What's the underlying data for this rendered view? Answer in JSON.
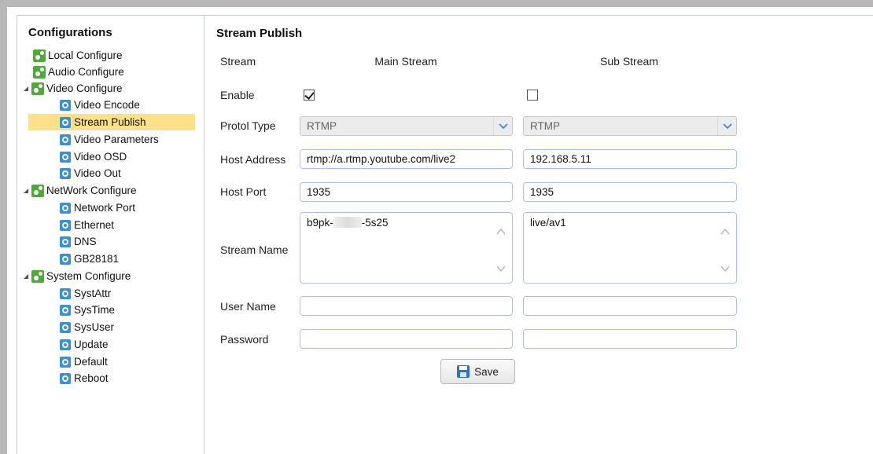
{
  "sidebar": {
    "title": "Configurations",
    "items": [
      {
        "label": "Local Configure"
      },
      {
        "label": "Audio Configure"
      },
      {
        "label": "Video Configure"
      },
      {
        "label": "Video Encode"
      },
      {
        "label": "Stream Publish"
      },
      {
        "label": "Video Parameters"
      },
      {
        "label": "Video OSD"
      },
      {
        "label": "Video Out"
      },
      {
        "label": "NetWork Configure"
      },
      {
        "label": "Network Port"
      },
      {
        "label": "Ethernet"
      },
      {
        "label": "DNS"
      },
      {
        "label": "GB28181"
      },
      {
        "label": "System Configure"
      },
      {
        "label": "SystAttr"
      },
      {
        "label": "SysTime"
      },
      {
        "label": "SysUser"
      },
      {
        "label": "Update"
      },
      {
        "label": "Default"
      },
      {
        "label": "Reboot"
      }
    ],
    "selected": "Stream Publish"
  },
  "form": {
    "title": "Stream Publish",
    "labels": {
      "stream": "Stream",
      "enable": "Enable",
      "protocol_type": "Protol Type",
      "host_address": "Host Address",
      "host_port": "Host Port",
      "stream_name": "Stream Name",
      "user_name": "User Name",
      "password": "Password"
    },
    "main": {
      "header": "Main Stream",
      "enabled": true,
      "protocol": "RTMP",
      "host_address": "rtmp://a.rtmp.youtube.com/live2",
      "host_port": "1935",
      "stream_name_prefix": "b9pk-",
      "stream_name_suffix": "-5s25",
      "user_name": "",
      "password": ""
    },
    "sub": {
      "header": "Sub Stream",
      "enabled": false,
      "protocol": "RTMP",
      "host_address": "192.168.5.11",
      "host_port": "1935",
      "stream_name": "live/av1",
      "user_name": "",
      "password": ""
    },
    "save_label": "Save"
  }
}
